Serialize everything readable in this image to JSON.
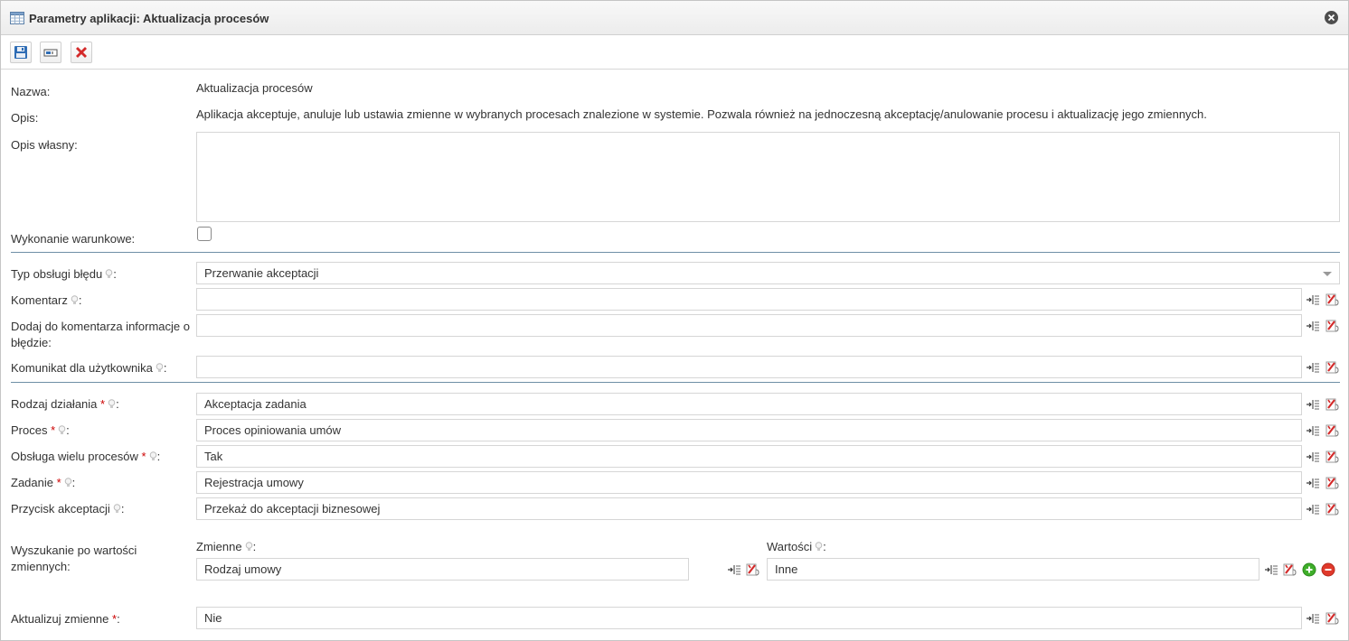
{
  "window": {
    "title": "Parametry aplikacji: Aktualizacja procesów",
    "title_icon": "table-icon",
    "close_icon": "close-circle-icon"
  },
  "toolbar": {
    "buttons": [
      {
        "icon": "save-icon"
      },
      {
        "icon": "variable-field-icon"
      },
      {
        "icon": "cancel-x-icon"
      }
    ]
  },
  "form": {
    "name_label": "Nazwa:",
    "name_value": "Aktualizacja procesów",
    "desc_label": "Opis:",
    "desc_value": "Aplikacja akceptuje, anuluje lub ustawia zmienne w wybranych procesach znalezione w systemie. Pozwala również na jednoczesną akceptację/anulowanie procesu i aktualizację jego zmiennych.",
    "own_desc_label": "Opis własny:",
    "own_desc_value": "",
    "conditional_label": "Wykonanie warunkowe:",
    "conditional_checked": false,
    "error_type_label": "Typ obsługi błędu",
    "error_type_value": "Przerwanie akceptacji",
    "comment_label": "Komentarz",
    "comment_value": "",
    "add_error_info_label": "Dodaj do komentarza informacje o błędzie:",
    "add_error_info_value": "",
    "user_message_label": "Komunikat dla użytkownika",
    "user_message_value": "",
    "action_type_label": "Rodzaj działania",
    "action_type_value": "Akceptacja zadania",
    "process_label": "Proces",
    "process_value": "Proces opiniowania umów",
    "multi_process_label": "Obsługa wielu procesów",
    "multi_process_value": "Tak",
    "task_label": "Zadanie",
    "task_value": "Rejestracja umowy",
    "accept_button_label": "Przycisk akceptacji",
    "accept_button_value": "Przekaż do akceptacji biznesowej",
    "var_search_label": "Wyszukanie po wartości zmiennych:",
    "variables_label": "Zmienne",
    "variables_value": "Rodzaj umowy",
    "values_label": "Wartości",
    "values_value": "Inne",
    "update_vars_label": "Aktualizuj zmienne",
    "update_vars_value": "Nie",
    "required_mark": "*",
    "colon": ":"
  }
}
